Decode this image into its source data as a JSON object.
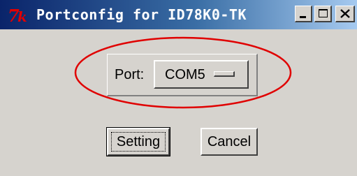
{
  "window": {
    "title": "Portconfig for ID78K0-TK",
    "icon": "tk-icon",
    "controls": {
      "minimize": "minimize-icon",
      "maximize": "maximize-icon",
      "close": "close-icon"
    }
  },
  "port": {
    "label": "Port:",
    "selected": "COM5"
  },
  "buttons": {
    "setting": "Setting",
    "cancel": "Cancel"
  },
  "annotation": {
    "color": "#e00000",
    "shape": "ellipse"
  },
  "colors": {
    "window_bg": "#d6d3ce",
    "title_gradient_start": "#0a246a",
    "title_gradient_end": "#a6caf0",
    "tk_logo": "#e00000"
  }
}
